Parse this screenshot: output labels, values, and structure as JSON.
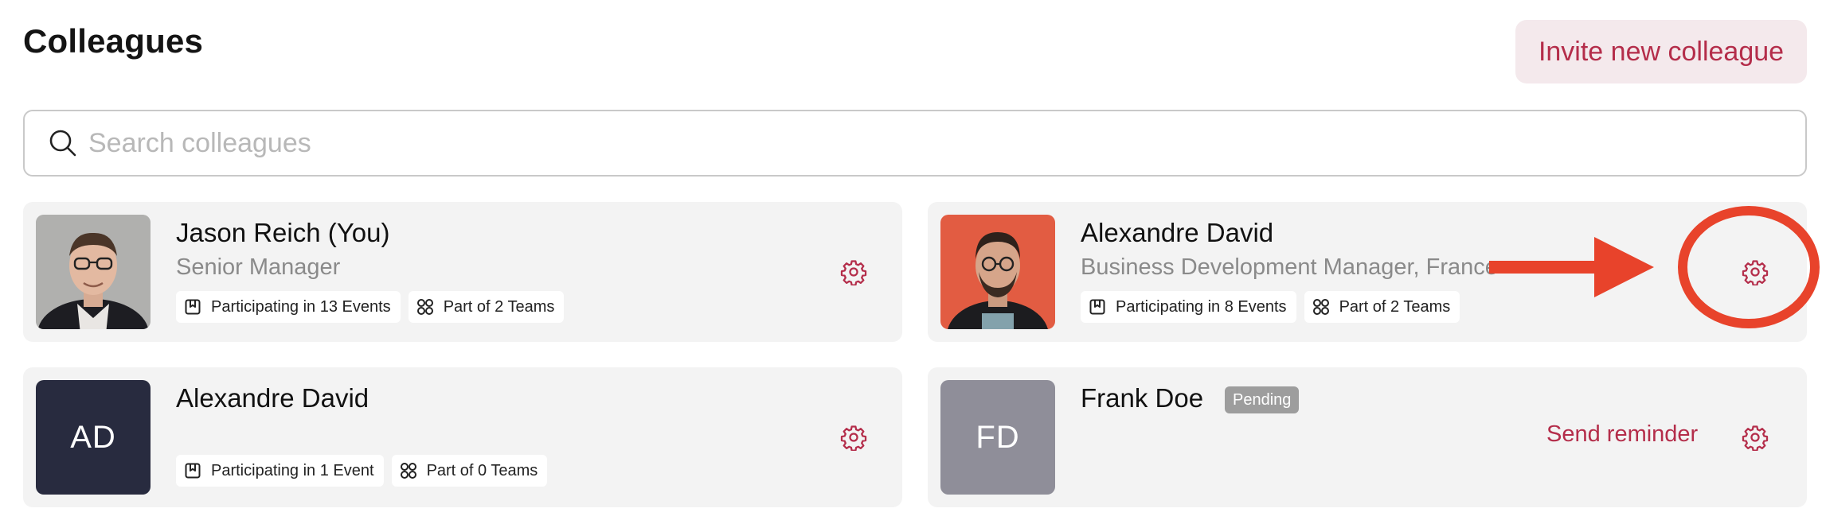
{
  "header": {
    "title": "Colleagues",
    "invite_label": "Invite new colleague"
  },
  "search": {
    "placeholder": "Search colleagues",
    "value": ""
  },
  "colleagues": [
    {
      "name": "Jason Reich (You)",
      "title": "Senior Manager",
      "events": "Participating in 13 Events",
      "teams": "Part of 2 Teams",
      "avatar": "photo"
    },
    {
      "name": "Alexandre David",
      "title": "Business Development Manager, France",
      "events": "Participating in 8 Events",
      "teams": "Part of 2 Teams",
      "avatar": "photo"
    },
    {
      "name": "Alexandre David",
      "title": "",
      "events": "Participating in 1 Event",
      "teams": "Part of 0 Teams",
      "avatar_initials": "AD",
      "avatar_color": "#282b3f"
    },
    {
      "name": "Frank Doe",
      "status": "Pending",
      "reminder_label": "Send reminder",
      "avatar_initials": "FD",
      "avatar_color": "#8f8e99"
    }
  ],
  "icons": {
    "search": "search-icon",
    "settings": "gear-icon",
    "events": "bookmark-calendar-icon",
    "teams": "four-circles-icon"
  },
  "colors": {
    "accent": "#b42d4a",
    "invite_bg": "#f4e9ec",
    "card_bg": "#f3f3f3",
    "annotation": "#e8432b"
  }
}
